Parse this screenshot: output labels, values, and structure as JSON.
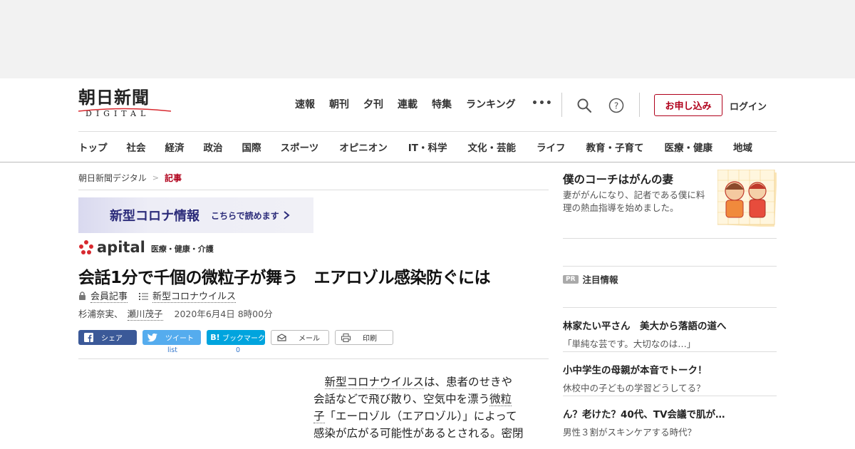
{
  "header": {
    "logo_main": "朝日新聞",
    "logo_sub": "DIGITAL",
    "topnav": [
      "速報",
      "朝刊",
      "夕刊",
      "連載",
      "特集",
      "ランキング"
    ],
    "more": "•••",
    "apply": "お申し込み",
    "login": "ログイン"
  },
  "categories": [
    "トップ",
    "社会",
    "経済",
    "政治",
    "国際",
    "スポーツ",
    "オピニオン",
    "IT・科学",
    "文化・芸能",
    "ライフ",
    "教育・子育て",
    "医療・健康",
    "地域"
  ],
  "breadcrumb": {
    "home": "朝日新聞デジタル",
    "sep": ">",
    "current": "記事"
  },
  "banner": {
    "title": "新型コロナ情報",
    "link": "こちらで読めます"
  },
  "apital": {
    "word": "apital",
    "category": "医療・健康・介護"
  },
  "article": {
    "headline": "会話1分で千個の微粒子が舞う　エアロゾル感染防ぐには",
    "member_tag": "会員記事",
    "topic_tag": "新型コロナウイルス",
    "author1": "杉浦奈実、",
    "author2": "瀬川茂子",
    "date": "2020年6月4日 8時00分",
    "body_line1_pre": "　",
    "body_line1_link": "新型コロナウイルス",
    "body_line1_post": "は、患者のせきや",
    "body_line2_pre": "会話などで飛び散り、空気中を漂う",
    "body_line2_link": "微粒",
    "body_line3_link": "子",
    "body_line3_post": "「エーロゾル（エアロゾル）」によって",
    "body_line4": "感染が広がる可能性があるとされる。密閉"
  },
  "share": {
    "facebook": "シェア",
    "twitter": "ツイート",
    "twitter_count": "list",
    "hatena": "ブックマーク",
    "hatena_icon": "B!",
    "hatena_count": "0",
    "mail": "メール",
    "print": "印刷"
  },
  "sidebar": {
    "promo_title": "僕のコーチはがんの妻",
    "promo_desc": "妻ががんになり、記者である僕に料理の熱血指導を始めました。",
    "pick_badge": "PR",
    "pick_label": "注目情報",
    "stories": [
      {
        "title": "林家たい平さん　美大から落語の道へ",
        "desc": "「単純な芸です。大切なのは…」"
      },
      {
        "title": "小中学生の母親が本音でトーク！",
        "desc": "休校中の子どもの学習どうしてる？"
      },
      {
        "title": "ん？老けた？40代、TV会議で肌が…",
        "desc": "男性３割がスキンケアする時代？"
      }
    ]
  },
  "colors": {
    "accent": "#b0001b",
    "facebook": "#3b5998",
    "twitter": "#55acee",
    "hatena": "#00a4de",
    "banner_text": "#2c2c7a"
  }
}
